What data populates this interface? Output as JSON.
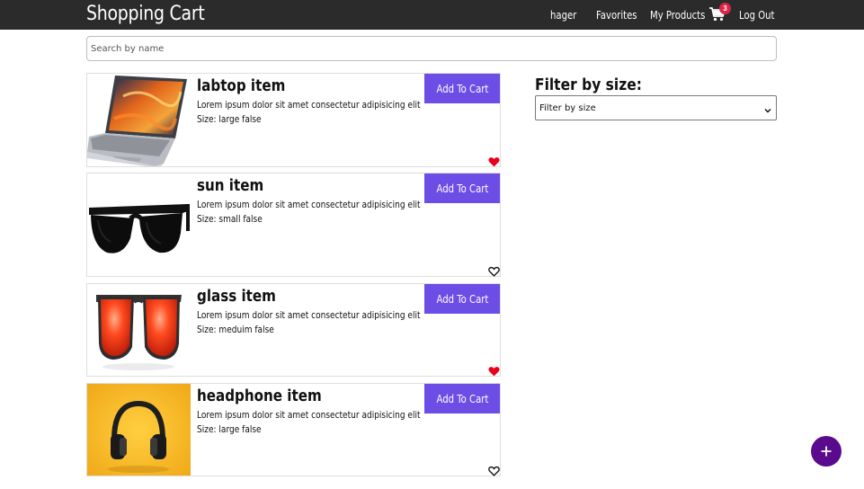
{
  "navbar": {
    "brand": "Shopping Cart",
    "links": {
      "user": "hager",
      "favorites": "Favorites",
      "my_products": "My Products",
      "logout": "Log Out"
    },
    "cart_count": "3"
  },
  "search": {
    "placeholder": "Search by name",
    "value": ""
  },
  "products": [
    {
      "title": "labtop item",
      "description": "Lorem ipsum dolor sit amet consectetur adipisicing elit",
      "size": "Size: large false",
      "button": "Add To Cart",
      "favorite": true
    },
    {
      "title": "sun item",
      "description": "Lorem ipsum dolor sit amet consectetur adipisicing elit",
      "size": "Size: small false",
      "button": "Add To Cart",
      "favorite": false
    },
    {
      "title": "glass item",
      "description": "Lorem ipsum dolor sit amet consectetur adipisicing elit",
      "size": "Size: meduim false",
      "button": "Add To Cart",
      "favorite": true
    },
    {
      "title": "headphone item",
      "description": "Lorem ipsum dolor sit amet consectetur adipisicing elit",
      "size": "Size: large false",
      "button": "Add To Cart",
      "favorite": false
    }
  ],
  "filter": {
    "label": "Filter by size:",
    "selected": "Filter by size"
  },
  "colors": {
    "navbar": "#2b2b2b",
    "accent": "#6c4de6",
    "heart": "#e8001c",
    "badge": "#dc2545",
    "fab": "#5a0a8c"
  },
  "icons": {
    "cart": "cart-icon",
    "heart_filled": "heart-filled-icon",
    "heart_outline": "heart-outline-icon",
    "add": "plus-icon"
  }
}
